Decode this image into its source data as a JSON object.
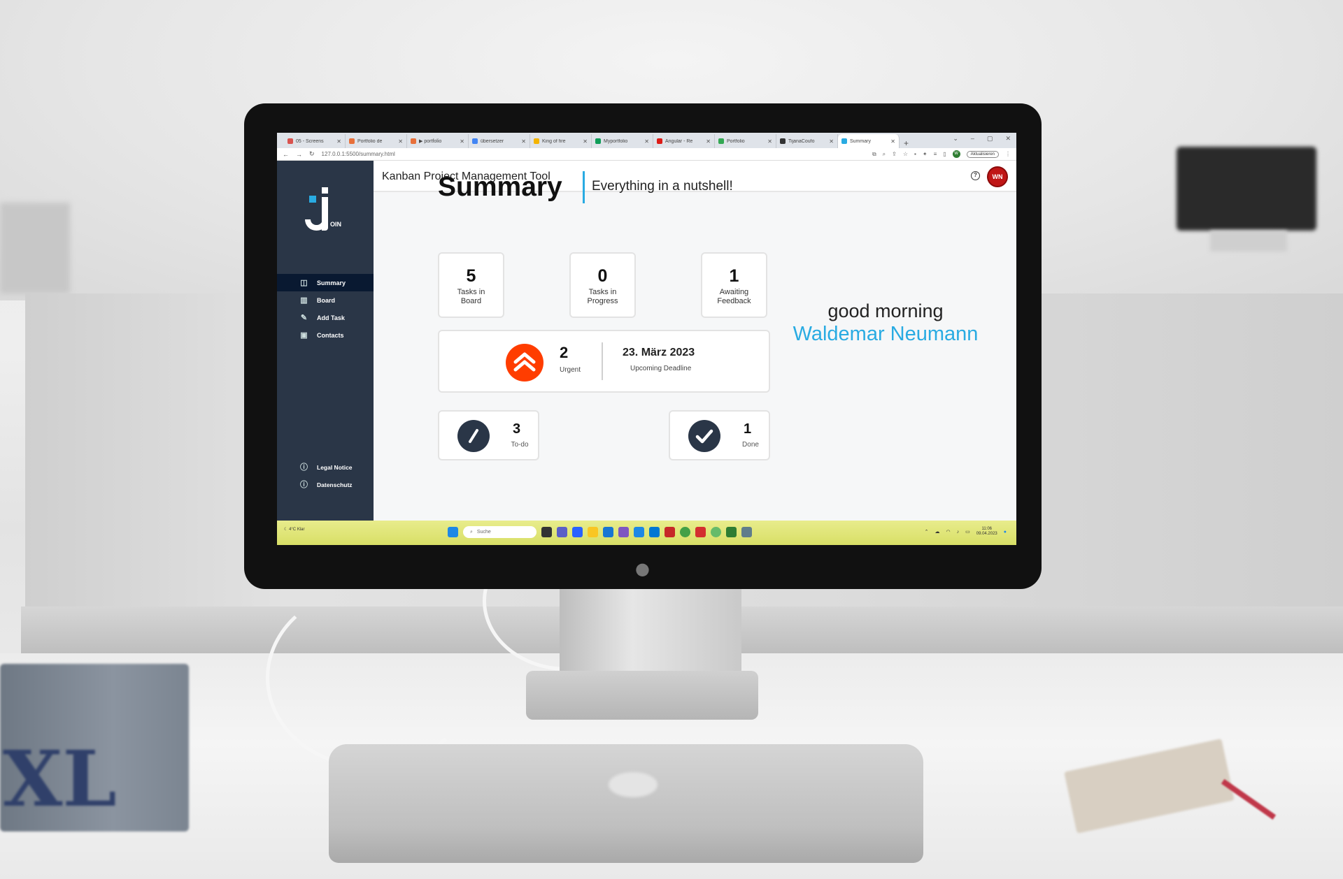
{
  "browser": {
    "tabs": [
      {
        "label": "05 - Screens",
        "color": "#d9534f"
      },
      {
        "label": "Portfolio de",
        "color": "#e8703a"
      },
      {
        "label": "▶ portfolio",
        "color": "#e8703a"
      },
      {
        "label": "übersetzer",
        "color": "#4285f4"
      },
      {
        "label": "King of fire",
        "color": "#f4b400"
      },
      {
        "label": "Myportfolio",
        "color": "#0f9d58"
      },
      {
        "label": "Angular - Re",
        "color": "#dd1b16"
      },
      {
        "label": "Portfolio",
        "color": "#34a853"
      },
      {
        "label": "TijanaCoufo",
        "color": "#333333"
      },
      {
        "label": "Summary",
        "color": "#29abe2"
      }
    ],
    "url": "127.0.0.1:5500/summary.html",
    "update_label": "Aktualisieren",
    "profile_initial": "W"
  },
  "app": {
    "header_title": "Kanban Project Management Tool",
    "user_initials": "WN",
    "logo_text": "OIN",
    "nav": [
      {
        "label": "Summary",
        "icon": "summary-icon"
      },
      {
        "label": "Board",
        "icon": "board-icon"
      },
      {
        "label": "Add Task",
        "icon": "add-task-icon"
      },
      {
        "label": "Contacts",
        "icon": "contacts-icon"
      }
    ],
    "legal": [
      {
        "label": "Legal Notice",
        "icon": "info-icon"
      },
      {
        "label": "Datenschutz",
        "icon": "info-icon"
      }
    ]
  },
  "summary": {
    "title": "Summary",
    "subtitle": "Everything in a nutshell!",
    "metrics": [
      {
        "value": "5",
        "label_line1": "Tasks in",
        "label_line2": "Board"
      },
      {
        "value": "0",
        "label_line1": "Tasks in",
        "label_line2": "Progress"
      },
      {
        "value": "1",
        "label_line1": "Awaiting",
        "label_line2": "Feedback"
      }
    ],
    "urgent": {
      "value": "2",
      "label": "Urgent"
    },
    "deadline": {
      "date": "23. März 2023",
      "label": "Upcoming Deadline"
    },
    "todo": {
      "value": "3",
      "label": "To-do"
    },
    "done": {
      "value": "1",
      "label": "Done"
    },
    "greeting": "good morning",
    "user_name": "Waldemar Neumann"
  },
  "taskbar": {
    "temperature": "4°C",
    "weather_text": "Klar",
    "search_placeholder": "Suche",
    "time": "11:06",
    "date": "09.04.2023"
  },
  "colors": {
    "sidebar": "#2a3647",
    "accent": "#29abe2",
    "urgent": "#ff3d00",
    "avatar": "#c01616"
  }
}
